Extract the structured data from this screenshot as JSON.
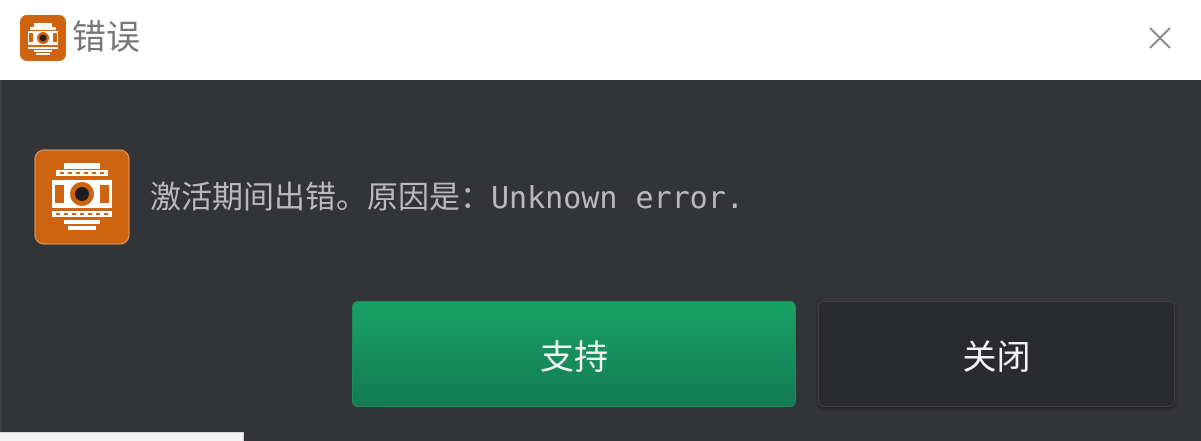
{
  "window": {
    "title": "错误"
  },
  "dialog": {
    "message_prefix": "激活期间出错。原因是：",
    "message_reason": "Unknown error."
  },
  "buttons": {
    "support_label": "支持",
    "close_label": "关闭"
  },
  "icons": {
    "app": "film-camera-icon",
    "close": "close-icon"
  },
  "colors": {
    "titlebar_bg": "#ffffff",
    "dialog_bg": "#333438",
    "accent_green": "#17935f",
    "icon_orange": "#cf6410",
    "text_light": "#b9b9bb"
  }
}
